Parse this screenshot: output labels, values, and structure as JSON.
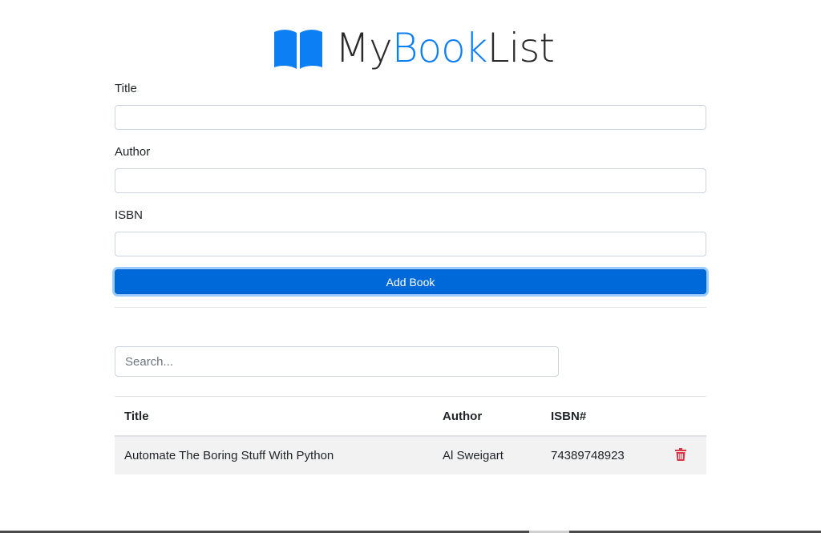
{
  "brand": {
    "part1": "My",
    "part2": "Book",
    "part3": "List",
    "icon": "book-open-icon",
    "accent_color": "#0d7ff5"
  },
  "form": {
    "title_label": "Title",
    "title_value": "",
    "author_label": "Author",
    "author_value": "",
    "isbn_label": "ISBN",
    "isbn_value": "",
    "submit_label": "Add Book"
  },
  "search": {
    "placeholder": "Search...",
    "value": ""
  },
  "table": {
    "headers": {
      "title": "Title",
      "author": "Author",
      "isbn": "ISBN#"
    },
    "rows": [
      {
        "title": "Automate The Boring Stuff With Python",
        "author": "Al Sweigart",
        "isbn": "74389748923",
        "action_icon": "trash-icon"
      }
    ]
  },
  "colors": {
    "primary_button": "#0069d9",
    "delete_icon": "#dc3545"
  }
}
